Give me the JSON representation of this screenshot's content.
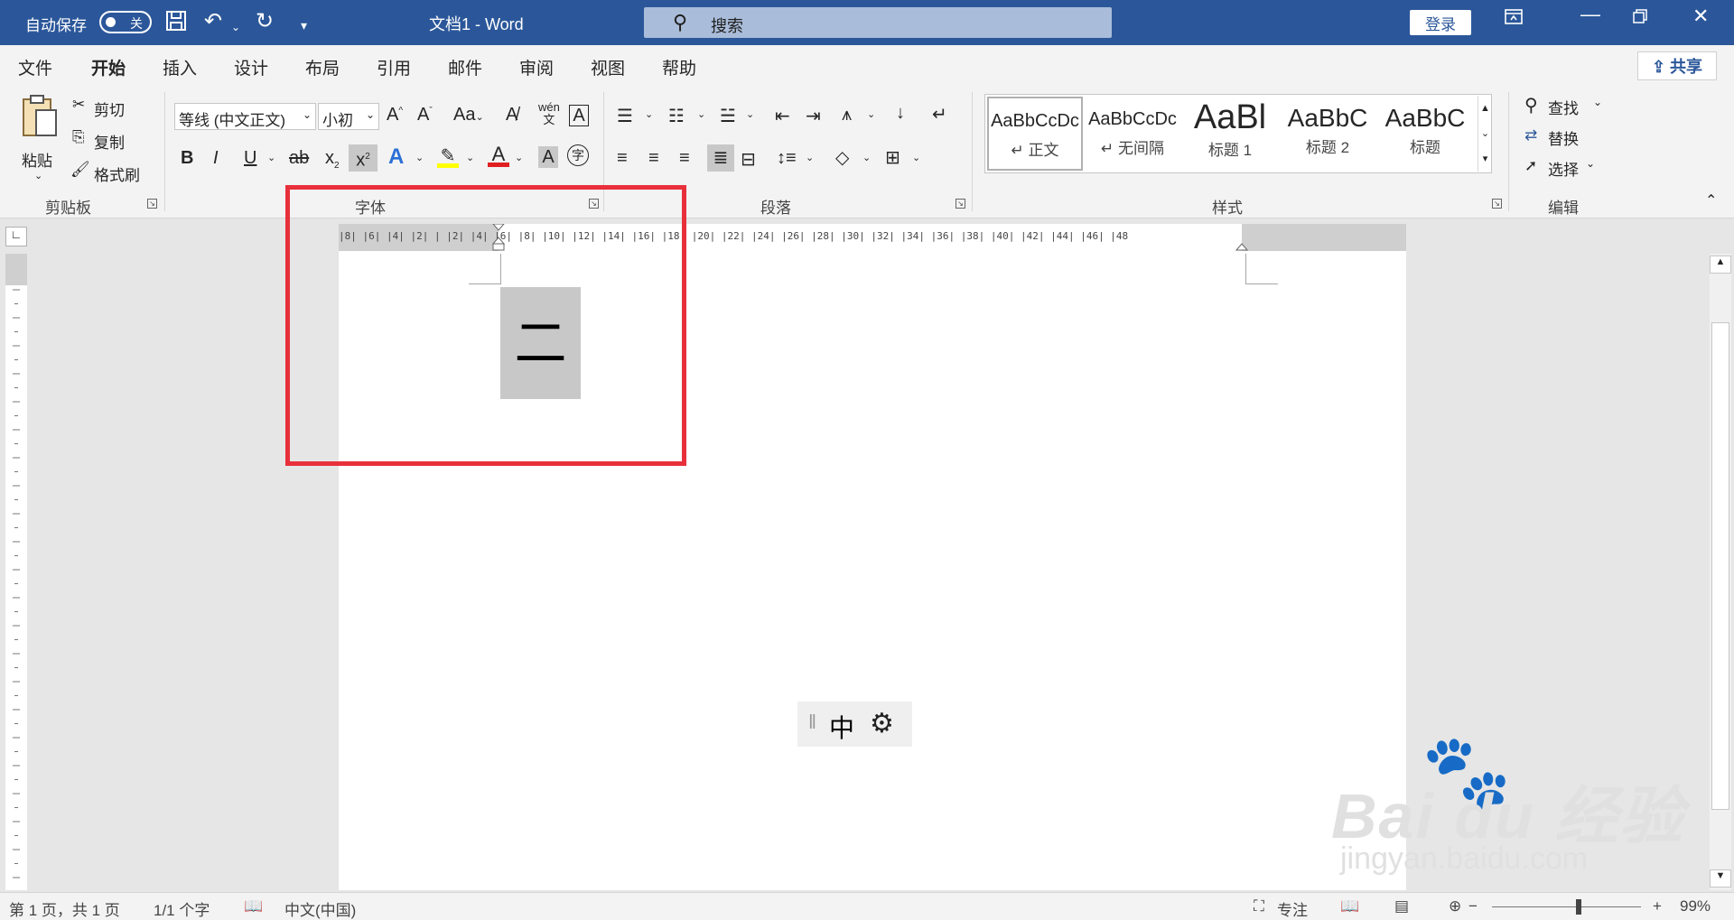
{
  "titlebar": {
    "autosave_label": "自动保存",
    "autosave_state": "关",
    "doc_title": "文档1  -  Word",
    "search_placeholder": "搜索",
    "login_label": "登录",
    "icons": [
      "save-icon",
      "undo-icon",
      "redo-icon",
      "customize-qat-icon",
      "ribbon-display-icon",
      "minimize-icon",
      "restore-icon",
      "close-icon"
    ]
  },
  "tabs": [
    {
      "label": "文件",
      "active": false
    },
    {
      "label": "开始",
      "active": true
    },
    {
      "label": "插入",
      "active": false
    },
    {
      "label": "设计",
      "active": false
    },
    {
      "label": "布局",
      "active": false
    },
    {
      "label": "引用",
      "active": false
    },
    {
      "label": "邮件",
      "active": false
    },
    {
      "label": "审阅",
      "active": false
    },
    {
      "label": "视图",
      "active": false
    },
    {
      "label": "帮助",
      "active": false
    }
  ],
  "share_label": "共享",
  "ribbon": {
    "clipboard": {
      "paste": "粘贴",
      "cut": "剪切",
      "copy": "复制",
      "format_painter": "格式刷",
      "group_label": "剪贴板"
    },
    "font": {
      "font_name": "等线 (中文正文)",
      "font_size": "小初",
      "group_label": "字体"
    },
    "paragraph": {
      "group_label": "段落"
    },
    "styles": {
      "items": [
        {
          "sample": "AaBbCcDc",
          "name": "↵ 正文",
          "selected": true
        },
        {
          "sample": "AaBbCcDc",
          "name": "↵ 无间隔",
          "selected": false
        },
        {
          "sample": "AaBl",
          "name": "标题 1",
          "selected": false
        },
        {
          "sample": "AaBbC",
          "name": "标题 2",
          "selected": false
        },
        {
          "sample": "AaBbC",
          "name": "标题",
          "selected": false
        }
      ],
      "group_label": "样式"
    },
    "editing": {
      "find": "查找",
      "replace": "替换",
      "select": "选择",
      "group_label": "编辑"
    }
  },
  "ruler": {
    "ticks": "|8|  |6|  |4|  |2|  |  |2|  |4|  |6|  |8|  |10| |12| |14| |16| |18| |20| |22| |24| |26| |28| |30| |32| |34| |36| |38| |40| |42| |44| |46| |48"
  },
  "document": {
    "selected_char": "二"
  },
  "ime": {
    "mode": "中"
  },
  "watermark": {
    "brand": "Bai du 经验",
    "url": "jingyan.baidu.com"
  },
  "statusbar": {
    "page": "第 1 页，共 1 页",
    "words": "1/1 个字",
    "language": "中文(中国)",
    "focus": "专注",
    "zoom": "99%",
    "zoom_minus": "−",
    "zoom_plus": "+"
  },
  "colors": {
    "accent": "#2b579a",
    "highlight_box": "#e8303b",
    "selection": "#c8c8c8"
  }
}
